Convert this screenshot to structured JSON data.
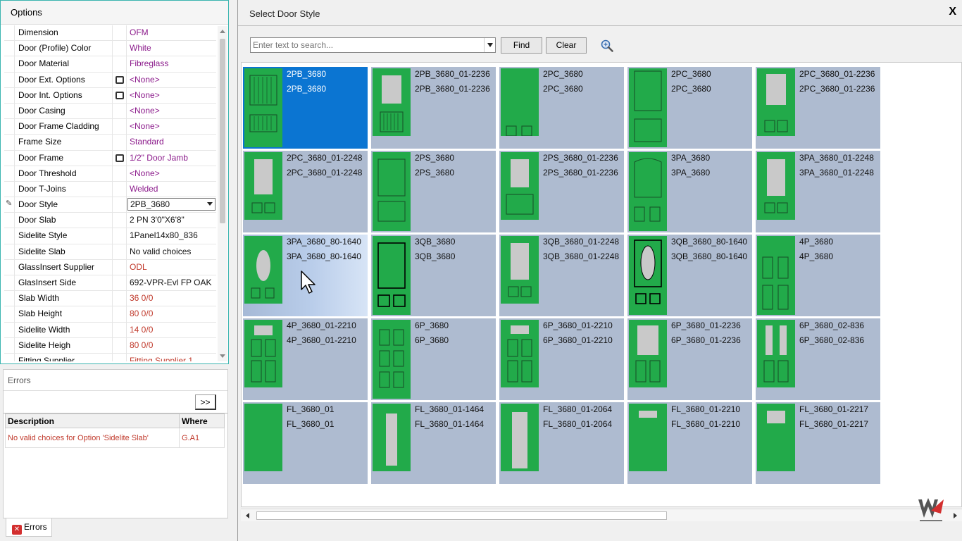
{
  "options_panel": {
    "title": "Options",
    "rows": [
      {
        "name": "Dimension",
        "value": "OFM"
      },
      {
        "name": "Door (Profile) Color",
        "value": "White"
      },
      {
        "name": "Door Material",
        "value": "Fibreglass"
      },
      {
        "name": "Door Ext. Options",
        "value": "<None>"
      },
      {
        "name": "Door Int. Options",
        "value": "<None>"
      },
      {
        "name": "Door Casing",
        "value": "<None>"
      },
      {
        "name": "Door Frame Cladding",
        "value": "<None>"
      },
      {
        "name": "Frame Size",
        "value": "Standard"
      },
      {
        "name": "Door Frame",
        "value": "1/2\" Door Jamb"
      },
      {
        "name": "Door Threshold",
        "value": "<None>"
      },
      {
        "name": "Door T-Joins",
        "value": "Welded"
      },
      {
        "name": "Door Style",
        "value": "2PB_3680"
      },
      {
        "name": "Door Slab",
        "value": "2 PN 3'0\"X6'8\""
      },
      {
        "name": "Sidelite Style",
        "value": "1Panel14x80_836"
      },
      {
        "name": "Sidelite Slab",
        "value": "No valid choices"
      },
      {
        "name": "GlassInsert Supplier",
        "value": "ODL"
      },
      {
        "name": "GlasInsert Side",
        "value": "692-VPR-Evl FP OAK"
      },
      {
        "name": "Slab Width",
        "value": "36 0/0"
      },
      {
        "name": "Slab Height",
        "value": "80 0/0"
      },
      {
        "name": "Sidelite Width",
        "value": "14 0/0"
      },
      {
        "name": "Sidelite Heigh",
        "value": "80 0/0"
      },
      {
        "name": "Fitting Supplier",
        "value": "Fitting Supplier 1"
      }
    ]
  },
  "errors_panel": {
    "title": "Errors",
    "expand_label": ">>",
    "columns": [
      "Description",
      "Where"
    ],
    "rows": [
      {
        "description": "No valid choices for Option 'Sidelite Slab'",
        "where": "G.A1"
      }
    ],
    "tab_label": "Errors"
  },
  "dialog": {
    "title": "Select Door Style",
    "close_label": "X",
    "search": {
      "placeholder": "Enter text to search..."
    },
    "find_label": "Find",
    "clear_label": "Clear",
    "tiles": [
      {
        "line1": "2PB_3680",
        "line2": "2PB_3680",
        "icon": "door-2pb",
        "state": "selected"
      },
      {
        "line1": "2PB_3680_01-2236",
        "line2": "2PB_3680_01-2236",
        "icon": "door-2pb-glass"
      },
      {
        "line1": "2PC_3680",
        "line2": "2PC_3680",
        "icon": "door-2pc-flat"
      },
      {
        "line1": "2PC_3680",
        "line2": "2PC_3680",
        "icon": "door-2pc"
      },
      {
        "line1": "2PC_3680_01-2236",
        "line2": "2PC_3680_01-2236",
        "icon": "door-2pc-glass"
      },
      {
        "line1": "2PC_3680_01-2248",
        "line2": "2PC_3680_01-2248",
        "icon": "door-2pc-glass-tall"
      },
      {
        "line1": "2PS_3680",
        "line2": "2PS_3680",
        "icon": "door-2ps"
      },
      {
        "line1": "2PS_3680_01-2236",
        "line2": "2PS_3680_01-2236",
        "icon": "door-2ps-glass"
      },
      {
        "line1": "3PA_3680",
        "line2": "3PA_3680",
        "icon": "door-3pa"
      },
      {
        "line1": "3PA_3680_01-2248",
        "line2": "3PA_3680_01-2248",
        "icon": "door-3pa-glass"
      },
      {
        "line1": "3PA_3680_80-1640",
        "line2": "3PA_3680_80-1640",
        "icon": "door-oval-glass",
        "state": "hover"
      },
      {
        "line1": "3QB_3680",
        "line2": "3QB_3680",
        "icon": "door-3qb"
      },
      {
        "line1": "3QB_3680_01-2248",
        "line2": "3QB_3680_01-2248",
        "icon": "door-3qb-glass"
      },
      {
        "line1": "3QB_3680_80-1640",
        "line2": "3QB_3680_80-1640",
        "icon": "door-3qb-oval"
      },
      {
        "line1": "4P_3680",
        "line2": "4P_3680",
        "icon": "door-4p"
      },
      {
        "line1": "4P_3680_01-2210",
        "line2": "4P_3680_01-2210",
        "icon": "door-4p-glass"
      },
      {
        "line1": "6P_3680",
        "line2": "6P_3680",
        "icon": "door-6p"
      },
      {
        "line1": "6P_3680_01-2210",
        "line2": "6P_3680_01-2210",
        "icon": "door-6p-glass"
      },
      {
        "line1": "6P_3680_01-2236",
        "line2": "6P_3680_01-2236",
        "icon": "door-6p-glass-tall"
      },
      {
        "line1": "6P_3680_02-836",
        "line2": "6P_3680_02-836",
        "icon": "door-6p-two-glass"
      },
      {
        "line1": "FL_3680_01",
        "line2": "FL_3680_01",
        "icon": "door-flush"
      },
      {
        "line1": "FL_3680_01-1464",
        "line2": "FL_3680_01-1464",
        "icon": "door-flush-narrow-glass"
      },
      {
        "line1": "FL_3680_01-2064",
        "line2": "FL_3680_01-2064",
        "icon": "door-flush-full-glass"
      },
      {
        "line1": "FL_3680_01-2210",
        "line2": "FL_3680_01-2210",
        "icon": "door-flush-top-glass"
      },
      {
        "line1": "FL_3680_01-2217",
        "line2": "FL_3680_01-2217",
        "icon": "door-flush-small-glass"
      }
    ]
  },
  "colors": {
    "door_green": "#22aa4a",
    "glass_gray": "#c9c9c9",
    "tile_bg": "#aebbd0",
    "selected_bg": "#0b75d2",
    "value_purple": "#8b1a8b",
    "error_red": "#c0392b"
  }
}
